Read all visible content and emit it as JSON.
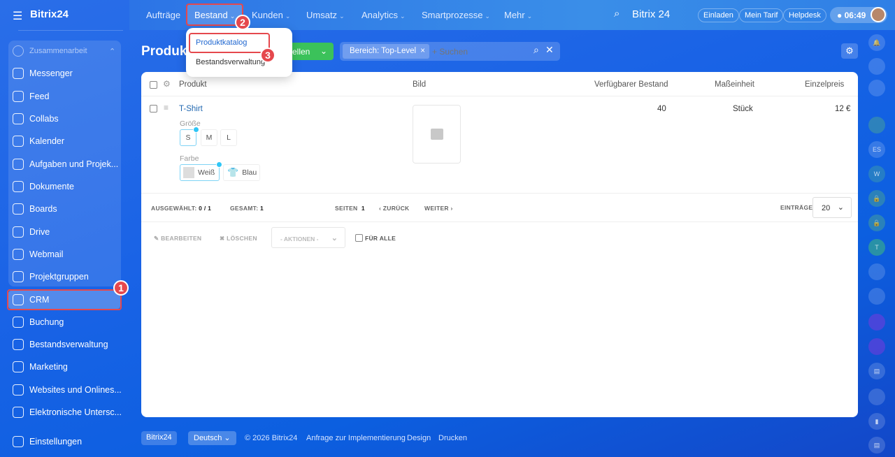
{
  "app": {
    "logo": "Bitrix24"
  },
  "topnav": {
    "items": [
      "Aufträge",
      "Bestand",
      "Kunden",
      "Umsatz",
      "Analytics",
      "Smartprozesse",
      "Mehr"
    ],
    "brand": "Bitrix 24",
    "buttons": [
      "Einladen",
      "Mein Tarif",
      "Helpdesk"
    ],
    "time": "06:49"
  },
  "dropdown": {
    "items": [
      "Produktkatalog",
      "Bestandsverwaltung"
    ]
  },
  "annotations": [
    "1",
    "2",
    "3"
  ],
  "sidebar": {
    "group": "Zusammenarbeit",
    "items": [
      "Messenger",
      "Feed",
      "Collabs",
      "Kalender",
      "Aufgaben und Projek...",
      "Dokumente",
      "Boards",
      "Drive",
      "Webmail",
      "Projektgruppen",
      "CRM",
      "Buchung",
      "Bestandsverwaltung",
      "Marketing",
      "Websites und Onlines...",
      "Elektronische Untersc...",
      "Einstellungen"
    ]
  },
  "page": {
    "title": "Produkt",
    "create_label": "ellen",
    "filter_tag": "Bereich: Top-Level",
    "search_placeholder": "+ Suchen"
  },
  "table": {
    "headers": [
      "Produkt",
      "Bild",
      "Verfügbarer Bestand",
      "Maßeinheit",
      "Einzelpreis"
    ],
    "row": {
      "name": "T-Shirt",
      "size_label": "Größe",
      "sizes": [
        "S",
        "M",
        "L"
      ],
      "color_label": "Farbe",
      "colors": [
        "Weiß",
        "Blau"
      ],
      "stock": "40",
      "unit": "Stück",
      "price": "12 €"
    }
  },
  "pager": {
    "selected_label": "AUSGEWÄHLT:",
    "selected": "0 / 1",
    "total_label": "GESAMT:",
    "total": "1",
    "pages_label": "SEITEN",
    "page": "1",
    "prev": "ZURÜCK",
    "next": "WEITER",
    "entries_label": "EINTRÄGE",
    "entries": "20"
  },
  "actions": {
    "edit": "BEARBEITEN",
    "delete": "LÖSCHEN",
    "actions": "- AKTIONEN -",
    "for_all": "FÜR ALLE"
  },
  "footer": {
    "brand": "Bitrix24",
    "language": "Deutsch",
    "copyright": "© 2026 Bitrix24",
    "links": [
      "Anfrage zur Implementierung",
      "Design",
      "Drucken"
    ]
  },
  "rightbar": {
    "labels": [
      "ES",
      "W",
      "T"
    ]
  }
}
